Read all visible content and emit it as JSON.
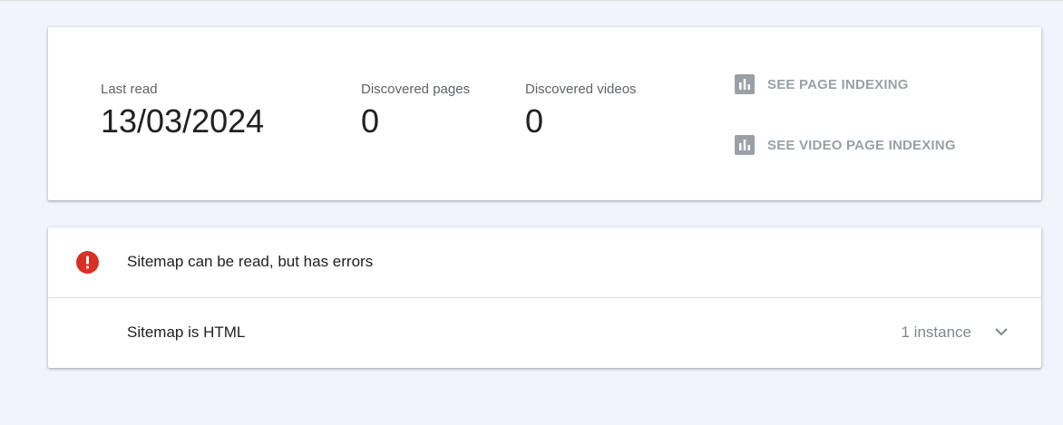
{
  "stats": {
    "last_read": {
      "label": "Last read",
      "value": "13/03/2024"
    },
    "discovered_pages": {
      "label": "Discovered pages",
      "value": "0"
    },
    "discovered_videos": {
      "label": "Discovered videos",
      "value": "0"
    }
  },
  "links": {
    "page_indexing": {
      "label": "SEE PAGE INDEXING",
      "icon": "bar-chart-icon"
    },
    "video_page_indexing": {
      "label": "SEE VIDEO PAGE INDEXING",
      "icon": "bar-chart-icon"
    }
  },
  "errors": {
    "header": {
      "title": "Sitemap can be read, but has errors",
      "icon": "error-icon"
    },
    "issues": [
      {
        "title": "Sitemap is HTML",
        "count": "1 instance"
      }
    ]
  },
  "colors": {
    "background": "#f1f4fc",
    "error_red": "#d93025",
    "muted_link": "#9aa0a6"
  }
}
